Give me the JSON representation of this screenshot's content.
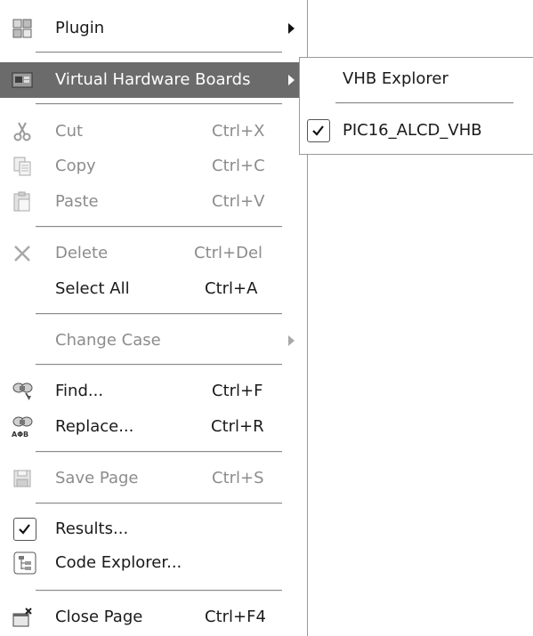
{
  "menu": {
    "plugin": {
      "label": "Plugin",
      "icon": "plugin-icon"
    },
    "virtual_hardware": {
      "label": "Virtual Hardware Boards",
      "icon": "hardware-board-icon"
    },
    "cut": {
      "label": "Cut",
      "shortcut": "Ctrl+X",
      "icon": "scissors-icon"
    },
    "copy": {
      "label": "Copy",
      "shortcut": "Ctrl+C",
      "icon": "copy-icon"
    },
    "paste": {
      "label": "Paste",
      "shortcut": "Ctrl+V",
      "icon": "paste-icon"
    },
    "delete": {
      "label": "Delete",
      "shortcut": "Ctrl+Del",
      "icon": "delete-icon"
    },
    "select_all": {
      "label": "Select All",
      "shortcut": "Ctrl+A"
    },
    "change_case": {
      "label": "Change Case"
    },
    "find": {
      "label": "Find...",
      "shortcut": "Ctrl+F",
      "icon": "find-icon"
    },
    "replace": {
      "label": "Replace...",
      "shortcut": "Ctrl+R",
      "icon": "replace-icon"
    },
    "save_page": {
      "label": "Save Page",
      "shortcut": "Ctrl+S",
      "icon": "save-icon"
    },
    "results": {
      "label": "Results...",
      "checked": true
    },
    "code_explorer": {
      "label": "Code Explorer...",
      "icon": "code-explorer-icon"
    },
    "close_page": {
      "label": "Close Page",
      "shortcut": "Ctrl+F4",
      "icon": "close-page-icon"
    }
  },
  "submenu": {
    "vhb_explorer": {
      "label": "VHB Explorer"
    },
    "pic16": {
      "label": "PIC16_ALCD_VHB",
      "checked": true
    }
  },
  "colors": {
    "highlight": "#6b6b6b",
    "disabled_text": "#8c8c8c",
    "separator": "#8a8a8a"
  }
}
